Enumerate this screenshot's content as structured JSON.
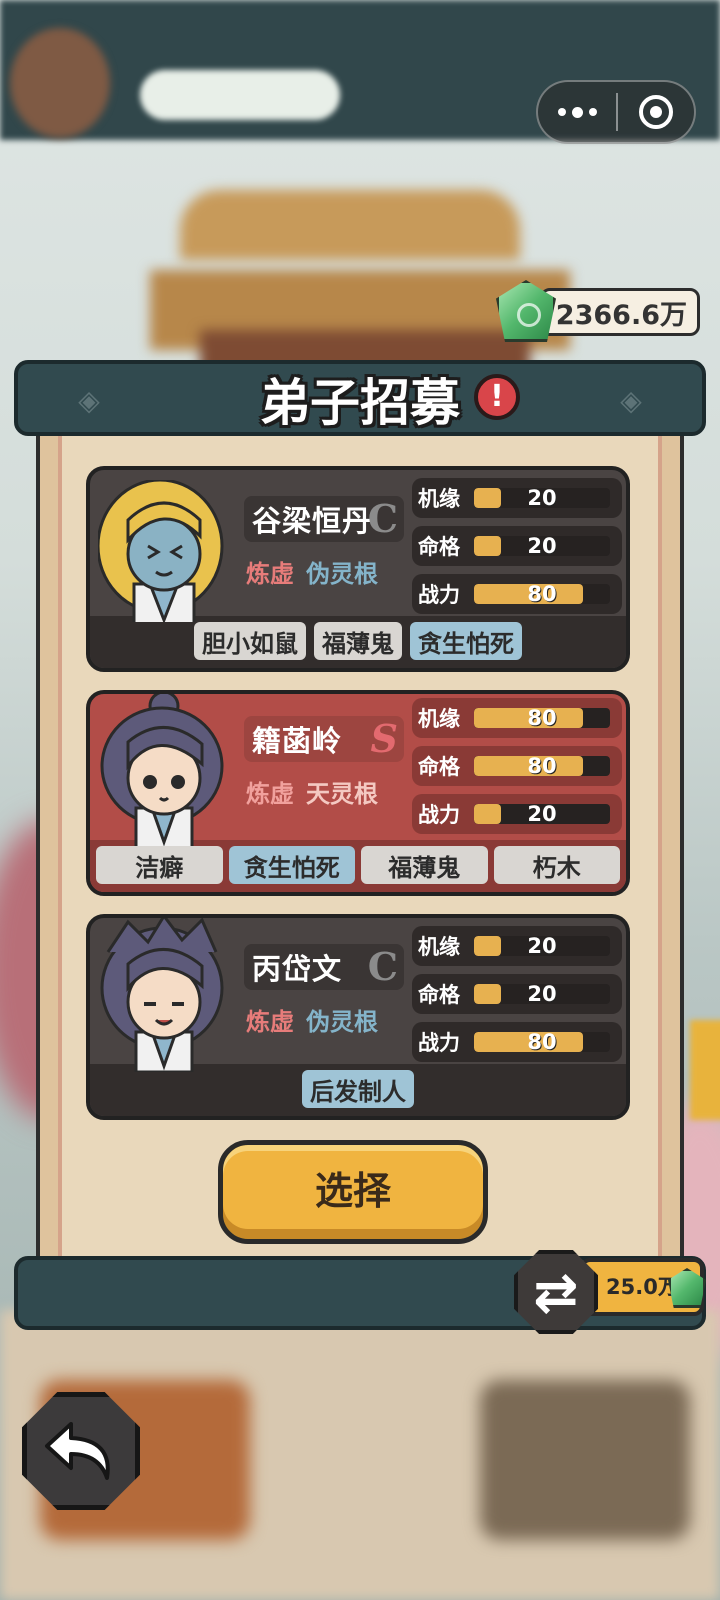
{
  "title": "弟子招募",
  "currency": {
    "amount": "2366.6万"
  },
  "disciples": [
    {
      "name": "谷梁恒丹",
      "grade": "C",
      "realm": "炼虚",
      "root": "伪灵根",
      "stats": [
        {
          "label": "机缘",
          "value": "20",
          "level": 0.2
        },
        {
          "label": "命格",
          "value": "20",
          "level": 0.2
        },
        {
          "label": "战力",
          "value": "80",
          "level": 0.8
        }
      ],
      "traits": [
        "胆小如鼠",
        "福薄鬼",
        "贪生怕死"
      ]
    },
    {
      "name": "籍菡岭",
      "grade": "S",
      "realm": "炼虚",
      "root": "天灵根",
      "stats": [
        {
          "label": "机缘",
          "value": "80",
          "level": 0.8
        },
        {
          "label": "命格",
          "value": "80",
          "level": 0.8
        },
        {
          "label": "战力",
          "value": "20",
          "level": 0.2
        }
      ],
      "traits": [
        "洁癖",
        "贪生怕死",
        "福薄鬼",
        "朽木"
      ]
    },
    {
      "name": "丙岱文",
      "grade": "C",
      "realm": "炼虚",
      "root": "伪灵根",
      "stats": [
        {
          "label": "机缘",
          "value": "20",
          "level": 0.2
        },
        {
          "label": "命格",
          "value": "20",
          "level": 0.2
        },
        {
          "label": "战力",
          "value": "80",
          "level": 0.8
        }
      ],
      "traits": [
        "后发制人"
      ]
    }
  ],
  "select_label": "选择",
  "refresh": {
    "cost": "25.0万"
  },
  "icons": {
    "alert": "alert-icon",
    "gem": "jade-gem-icon",
    "refresh": "refresh-icon",
    "back": "back-arrow-icon",
    "menu": "more-dots-icon",
    "close": "close-circle-icon"
  },
  "colors": {
    "panel_dark": "#314a4f",
    "card_normal": "#4a4443",
    "card_special": "#b24d48",
    "stat_fill": "#e7b150",
    "button": "#f0b440",
    "trait_blue": "#9fc4d6"
  }
}
